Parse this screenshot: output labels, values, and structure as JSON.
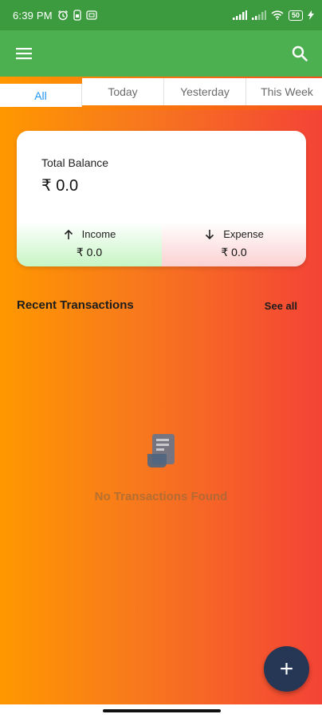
{
  "status_bar": {
    "time": "6:39 PM",
    "battery": "50",
    "icons": [
      "alarm-icon",
      "sim-icon",
      "screenshot-icon",
      "signal-icon",
      "signal-icon",
      "wifi-icon",
      "battery-icon",
      "charging-icon"
    ]
  },
  "app_bar": {
    "menu_icon": "hamburger-menu-icon",
    "search_icon": "search-icon"
  },
  "tabs": [
    {
      "label": "All",
      "active": true
    },
    {
      "label": "Today",
      "active": false
    },
    {
      "label": "Yesterday",
      "active": false
    },
    {
      "label": "This Week",
      "active": false
    }
  ],
  "balance_card": {
    "title": "Total Balance",
    "amount": "₹ 0.0",
    "income": {
      "label": "Income",
      "value": "₹ 0.0",
      "icon": "arrow-up-icon"
    },
    "expense": {
      "label": "Expense",
      "value": "₹ 0.0",
      "icon": "arrow-down-icon"
    }
  },
  "recent": {
    "title": "Recent Transactions",
    "see_all": "See all",
    "empty_text": "No Transactions Found",
    "empty_icon": "receipt-icon"
  },
  "fab": {
    "label": "+",
    "icon": "plus-icon"
  },
  "colors": {
    "status_bar": "#3c9a3f",
    "app_bar": "#4caf50",
    "gradient_start": "#ff9800",
    "gradient_end": "#f44336",
    "tab_active": "#2196f3",
    "fab": "#253754"
  }
}
